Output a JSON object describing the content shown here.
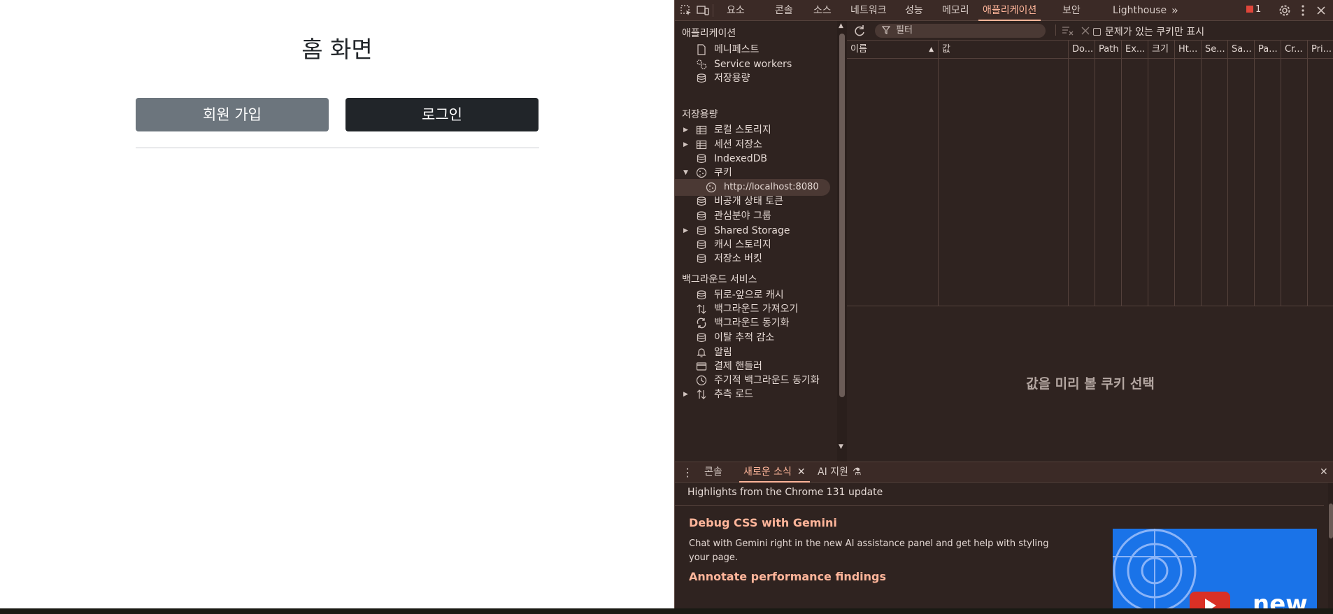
{
  "page": {
    "title": "홈 화면",
    "signup_label": "회원 가입",
    "login_label": "로그인"
  },
  "devtools": {
    "tabs": [
      "요소",
      "콘솔",
      "소스",
      "네트워크",
      "성능",
      "메모리",
      "애플리케이션",
      "보안",
      "Lighthouse"
    ],
    "active_tab": "애플리케이션",
    "issues_count": "1",
    "sidebar": {
      "application_header": "애플리케이션",
      "application_items": [
        {
          "label": "메니페스트",
          "icon": "file-icon"
        },
        {
          "label": "Service workers",
          "icon": "gears-icon"
        },
        {
          "label": "저장용량",
          "icon": "database-icon"
        }
      ],
      "storage_header": "저장용량",
      "storage_items": [
        {
          "label": "로컬 스토리지",
          "icon": "table-icon"
        },
        {
          "label": "세션 저장소",
          "icon": "table-icon"
        },
        {
          "label": "IndexedDB",
          "icon": "database-icon"
        },
        {
          "label": "쿠키",
          "icon": "cookie-icon"
        },
        {
          "label": "http://localhost:8080",
          "icon": "cookie-icon"
        },
        {
          "label": "비공개 상태 토큰",
          "icon": "database-icon"
        },
        {
          "label": "관심분야 그룹",
          "icon": "database-icon"
        },
        {
          "label": "Shared Storage",
          "icon": "database-icon"
        },
        {
          "label": "캐시 스토리지",
          "icon": "database-icon"
        },
        {
          "label": "저장소 버킷",
          "icon": "database-icon"
        }
      ],
      "background_header": "백그라운드 서비스",
      "background_items": [
        {
          "label": "뒤로-앞으로 캐시",
          "icon": "database-icon"
        },
        {
          "label": "백그라운드 가져오기",
          "icon": "updown-arrows-icon"
        },
        {
          "label": "백그라운드 동기화",
          "icon": "sync-icon"
        },
        {
          "label": "이탈 추적 감소",
          "icon": "database-icon"
        },
        {
          "label": "알림",
          "icon": "bell-icon"
        },
        {
          "label": "결제 핸들러",
          "icon": "card-icon"
        },
        {
          "label": "주기적 백그라운드 동기화",
          "icon": "clock-icon"
        },
        {
          "label": "추측 로드",
          "icon": "updown-arrows-icon"
        }
      ]
    },
    "cookies": {
      "filter_placeholder": "필터",
      "only_issues_label": "문제가 있는 쿠키만 표시",
      "columns": [
        "이름",
        "값",
        "Do...",
        "Path",
        "Ex...",
        "크기",
        "Ht...",
        "Se...",
        "Sa...",
        "Pa...",
        "Cr...",
        "Pri..."
      ],
      "preview_message": "값을 미리 볼 쿠키 선택"
    },
    "drawer": {
      "tabs": [
        "콘솔",
        "새로운 소식",
        "AI 지원"
      ],
      "active_tab": "새로운 소식",
      "highlights": "Highlights from the Chrome 131 update",
      "news": [
        {
          "title": "Debug CSS with Gemini",
          "body": "Chat with Gemini right in the new AI assistance panel and get help with styling your page."
        },
        {
          "title": "Annotate performance findings",
          "body": ""
        }
      ],
      "image_text": "new"
    }
  },
  "colors": {
    "signup_bg": "#6c757d",
    "login_bg": "#212529",
    "devtools_bg": "#2f2320",
    "accent": "#ffb59a"
  }
}
